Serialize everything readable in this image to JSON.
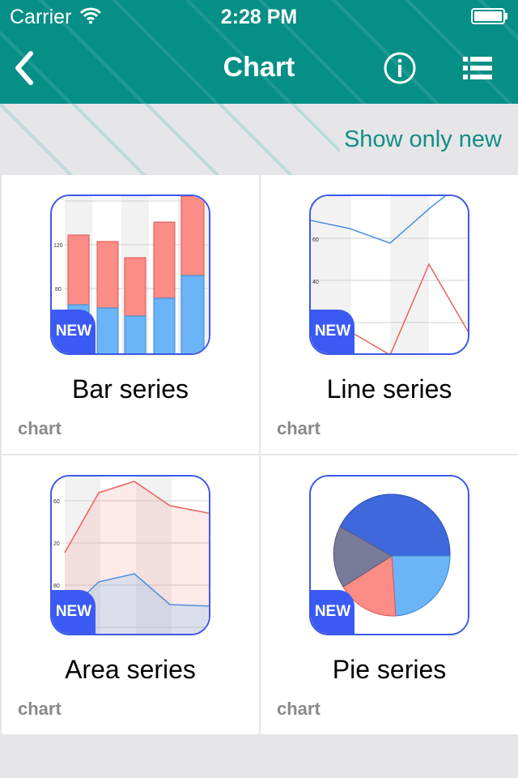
{
  "status_bar": {
    "carrier": "Carrier",
    "time": "2:28 PM"
  },
  "nav": {
    "title": "Chart",
    "back_icon": "chevron-left-icon",
    "info_icon": "info-icon",
    "list_icon": "list-icon"
  },
  "filter": {
    "label": "Show only new"
  },
  "colors": {
    "header": "#058f86",
    "accent_text": "#128e85",
    "badge": "#3b5af4",
    "thumb_border": "#3c5ae6"
  },
  "cards": [
    {
      "title": "Bar series",
      "tag": "chart",
      "badge": "NEW"
    },
    {
      "title": "Line series",
      "tag": "chart",
      "badge": "NEW"
    },
    {
      "title": "Area series",
      "tag": "chart",
      "badge": "NEW"
    },
    {
      "title": "Pie series",
      "tag": "chart",
      "badge": "NEW"
    }
  ]
}
